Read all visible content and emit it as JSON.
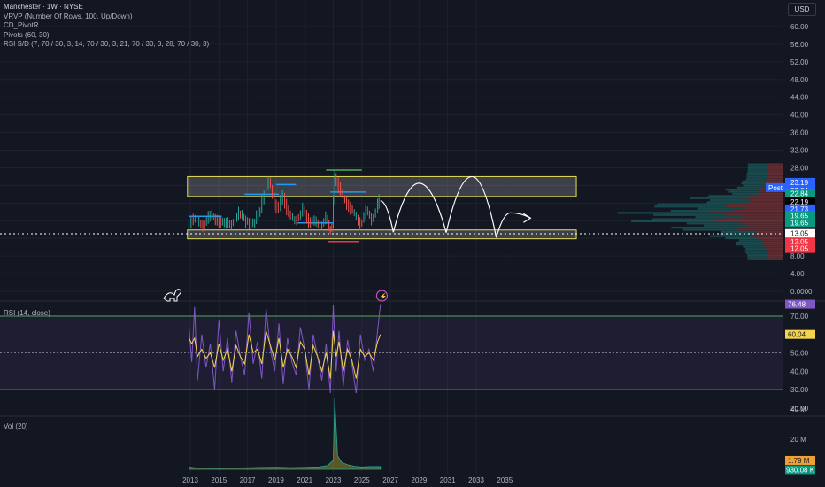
{
  "header": {
    "symbol_line": "Manchester · 1W · NYSE",
    "indicators": [
      "VRVP (Number Of Rows, 100, Up/Down)",
      "CD_PivotR",
      "Pivots (60, 30)",
      "RSI S/D (7, 70 / 30, 3, 14, 70 / 30, 3, 21, 70 / 30, 3, 28, 70 / 30, 3)"
    ],
    "currency": "USD"
  },
  "colors": {
    "background": "#131722",
    "grid": "#1e222d",
    "axis_text": "#b2b5be",
    "up_candle": "#26a69a",
    "down_candle": "#ef5350",
    "rsi_line": "#7e57c2",
    "rsi_ma": "#f5d44a",
    "zone_border": "#e6e052",
    "volume_fill": "#b3a92a"
  },
  "chart_data": [
    {
      "type": "line",
      "panel": "price",
      "x_ticks": [
        "2013",
        "2015",
        "2017",
        "2019",
        "2021",
        "2023",
        "2025",
        "2027",
        "2029",
        "2031",
        "2033",
        "2035"
      ],
      "y_ticks": [
        60.0,
        56.0,
        52.0,
        48.0,
        44.0,
        40.0,
        36.0,
        32.0,
        28.0,
        24.0,
        20.0,
        16.0,
        12.0,
        8.0,
        4.0,
        0.0
      ],
      "y_tick_labels": [
        "60.00",
        "56.00",
        "52.00",
        "48.00",
        "44.00",
        "40.00",
        "36.00",
        "32.00",
        "28.00",
        "24.00",
        "20.00",
        "16.00",
        "12.00",
        "8.00",
        "4.00",
        "0.0000"
      ],
      "ylim": [
        0,
        62
      ],
      "x": [
        2012.9,
        2013.2,
        2013.6,
        2014.0,
        2014.5,
        2015.0,
        2015.5,
        2016.0,
        2016.5,
        2017.0,
        2017.5,
        2018.0,
        2018.3,
        2018.6,
        2019.0,
        2019.3,
        2019.6,
        2020.0,
        2020.3,
        2020.7,
        2021.0,
        2021.4,
        2021.8,
        2022.2,
        2022.6,
        2022.8,
        2023.0,
        2023.2,
        2023.5,
        2023.8,
        2024.2,
        2024.6,
        2025.0,
        2025.4,
        2025.8,
        2026.1,
        2026.3
      ],
      "close": [
        13.5,
        16.8,
        15.5,
        15.2,
        17.0,
        16.4,
        15.0,
        15.6,
        17.5,
        16.0,
        15.2,
        18.5,
        22.5,
        25.0,
        20.0,
        19.0,
        21.5,
        17.5,
        16.0,
        17.0,
        18.5,
        16.0,
        15.5,
        15.0,
        16.5,
        14.0,
        15.0,
        26.0,
        24.0,
        21.0,
        19.5,
        17.0,
        15.5,
        18.0,
        16.5,
        18.5,
        20.5
      ],
      "projection_note": "",
      "zones": [
        {
          "low": 21.5,
          "high": 26.0,
          "label": ""
        },
        {
          "low": 11.9,
          "high": 13.9,
          "label": ""
        }
      ],
      "last_price": 13.05,
      "price_labels": [
        {
          "text": "23.19",
          "value": 24.7,
          "color": "#2962ff"
        },
        {
          "text": "22.84",
          "value": 22.9,
          "color": "#2962ff"
        },
        {
          "text": "22.84",
          "value": 22.2,
          "color": "#089981"
        },
        {
          "text": "22.19",
          "value": 20.3,
          "color": "#000000"
        },
        {
          "text": "21.73",
          "value": 18.7,
          "color": "#2962ff"
        },
        {
          "text": "19.65",
          "value": 17.2,
          "color": "#089981"
        },
        {
          "text": "19.65",
          "value": 15.6,
          "color": "#089981"
        },
        {
          "text": "13.05",
          "value": 13.1,
          "color": "#ffffff"
        },
        {
          "text": "12.05",
          "value": 11.2,
          "color": "#f23645"
        },
        {
          "text": "12.05",
          "value": 9.7,
          "color": "#f23645"
        }
      ],
      "post_label": "Post"
    },
    {
      "type": "line",
      "panel": "rsi",
      "title": "RSI (14, close)",
      "y_ticks": [
        70.0,
        60.0,
        50.0,
        40.0,
        30.0,
        20.0
      ],
      "y_tick_labels": [
        "70.00",
        "60.00",
        "50.00",
        "40.00",
        "30.00",
        "20.00"
      ],
      "ylim": [
        15,
        80
      ],
      "upper_band": 70,
      "lower_band": 30,
      "mid": 50,
      "current_rsi": "76.48",
      "current_ma": "60.04",
      "x": [
        2012.9,
        2013.1,
        2013.3,
        2013.5,
        2013.8,
        2014.1,
        2014.4,
        2014.7,
        2015.0,
        2015.3,
        2015.6,
        2015.9,
        2016.2,
        2016.5,
        2016.8,
        2017.1,
        2017.4,
        2017.7,
        2018.0,
        2018.3,
        2018.6,
        2018.9,
        2019.2,
        2019.5,
        2019.8,
        2020.1,
        2020.4,
        2020.7,
        2021.0,
        2021.3,
        2021.6,
        2021.9,
        2022.2,
        2022.5,
        2022.8,
        2023.0,
        2023.2,
        2023.4,
        2023.7,
        2024.0,
        2024.3,
        2024.6,
        2024.9,
        2025.2,
        2025.5,
        2025.8,
        2026.1,
        2026.3
      ],
      "rsi": [
        65,
        45,
        75,
        35,
        60,
        42,
        55,
        30,
        68,
        40,
        58,
        34,
        62,
        48,
        38,
        72,
        44,
        56,
        36,
        74,
        52,
        40,
        66,
        33,
        58,
        45,
        38,
        64,
        52,
        30,
        60,
        48,
        35,
        55,
        28,
        76,
        40,
        62,
        32,
        57,
        44,
        28,
        60,
        46,
        52,
        40,
        62,
        76.5
      ],
      "rsi_ma": [
        58,
        55,
        58,
        48,
        52,
        47,
        50,
        42,
        55,
        46,
        52,
        40,
        54,
        48,
        44,
        60,
        50,
        52,
        44,
        62,
        54,
        46,
        58,
        42,
        52,
        48,
        42,
        56,
        52,
        38,
        54,
        48,
        40,
        50,
        36,
        62,
        48,
        56,
        40,
        52,
        46,
        36,
        52,
        48,
        50,
        46,
        56,
        60
      ]
    },
    {
      "type": "area",
      "panel": "volume",
      "title": "Vol (20)",
      "y_ticks": [
        40000000,
        20000000
      ],
      "y_tick_labels": [
        "40 M",
        "20 M"
      ],
      "ylim": [
        0,
        48000000
      ],
      "current_volume_ma": "1.79 M",
      "current_volume": "930.08 K",
      "x": [
        2012.9,
        2013.5,
        2014,
        2015,
        2016,
        2017,
        2018,
        2019,
        2020,
        2021,
        2022,
        2022.6,
        2023.0,
        2023.1,
        2023.3,
        2023.6,
        2024,
        2024.5,
        2025,
        2025.5,
        2026.3
      ],
      "values": [
        1500000,
        800000,
        900000,
        700000,
        900000,
        1000000,
        1200000,
        1400000,
        1100000,
        1300000,
        1600000,
        2500000,
        6000000,
        47000000,
        9000000,
        4500000,
        3000000,
        2000000,
        1500000,
        1800000,
        1790000
      ]
    }
  ]
}
